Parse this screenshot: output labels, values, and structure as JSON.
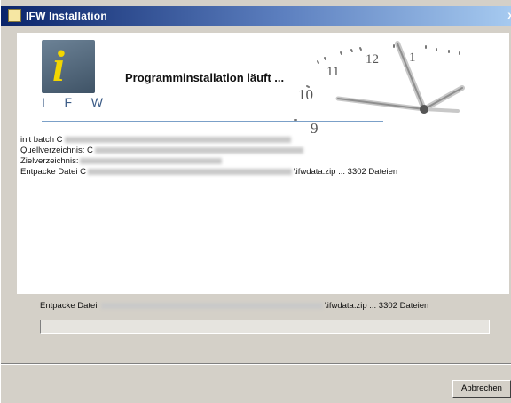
{
  "window": {
    "title": "IFW Installation",
    "close_glyph": "x"
  },
  "header": {
    "logo_letter": "i",
    "logo_letters": [
      "I",
      "F",
      "W"
    ],
    "heading": "Programminstallation läuft ..."
  },
  "clock": {
    "numbers": [
      "11",
      "12",
      "1",
      "10",
      "9"
    ]
  },
  "log": {
    "line1_prefix": "init batch C",
    "line2_prefix": "Quellverzeichnis: C",
    "line3_prefix": "Zielverzeichnis:",
    "line4_prefix": "Entpacke Datei C",
    "line4_suffix": "\\ifwdata.zip ... 3302 Dateien"
  },
  "status": {
    "prefix": "Entpacke Datei",
    "suffix": "\\ifwdata.zip ... 3302 Dateien"
  },
  "progress": {
    "value": 0
  },
  "buttons": {
    "cancel": "Abbrechen"
  }
}
